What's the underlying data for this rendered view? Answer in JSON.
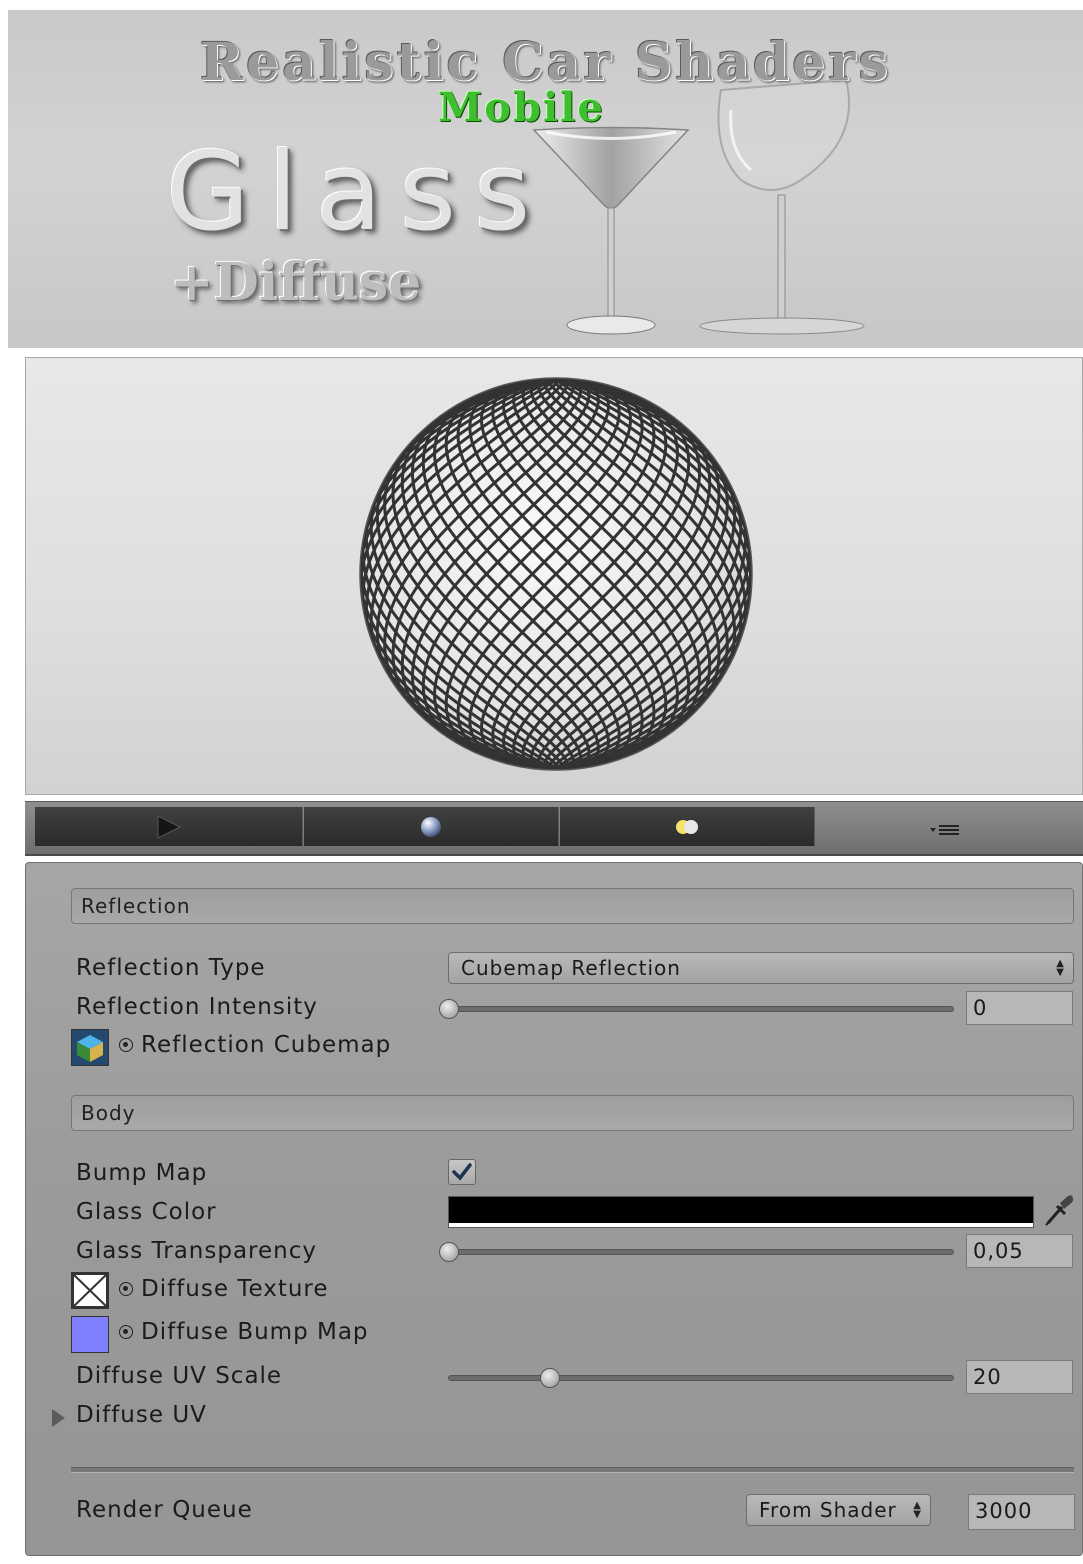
{
  "banner": {
    "title": "Realistic Car Shaders",
    "subtitle": "Mobile",
    "product": "Glass",
    "variant": "+Diffuse"
  },
  "toolbar": {
    "icons": [
      "play-icon",
      "sphere-icon",
      "light-icon",
      "menu-icon"
    ]
  },
  "inspector": {
    "reflection_section": "Reflection",
    "reflection_type_label": "Reflection Type",
    "reflection_type_value": "Cubemap Reflection",
    "reflection_intensity_label": "Reflection Intensity",
    "reflection_intensity_value": "0",
    "reflection_intensity_level": 0,
    "reflection_cubemap_label": "Reflection Cubemap",
    "body_section": "Body",
    "bump_map_label": "Bump Map",
    "bump_map_checked": true,
    "glass_color_label": "Glass Color",
    "glass_color": "#000000",
    "glass_transparency_label": "Glass Transparency",
    "glass_transparency_value": "0,05",
    "glass_transparency_level": 0,
    "diffuse_texture_label": "Diffuse Texture",
    "diffuse_bump_label": "Diffuse Bump Map",
    "diffuse_bump_color": "#8080ff",
    "diffuse_uv_scale_label": "Diffuse UV Scale",
    "diffuse_uv_scale_value": "20",
    "diffuse_uv_scale_level": 0.2,
    "diffuse_uv_label": "Diffuse UV",
    "render_queue_label": "Render Queue",
    "render_queue_mode": "From Shader",
    "render_queue_value": "3000"
  }
}
